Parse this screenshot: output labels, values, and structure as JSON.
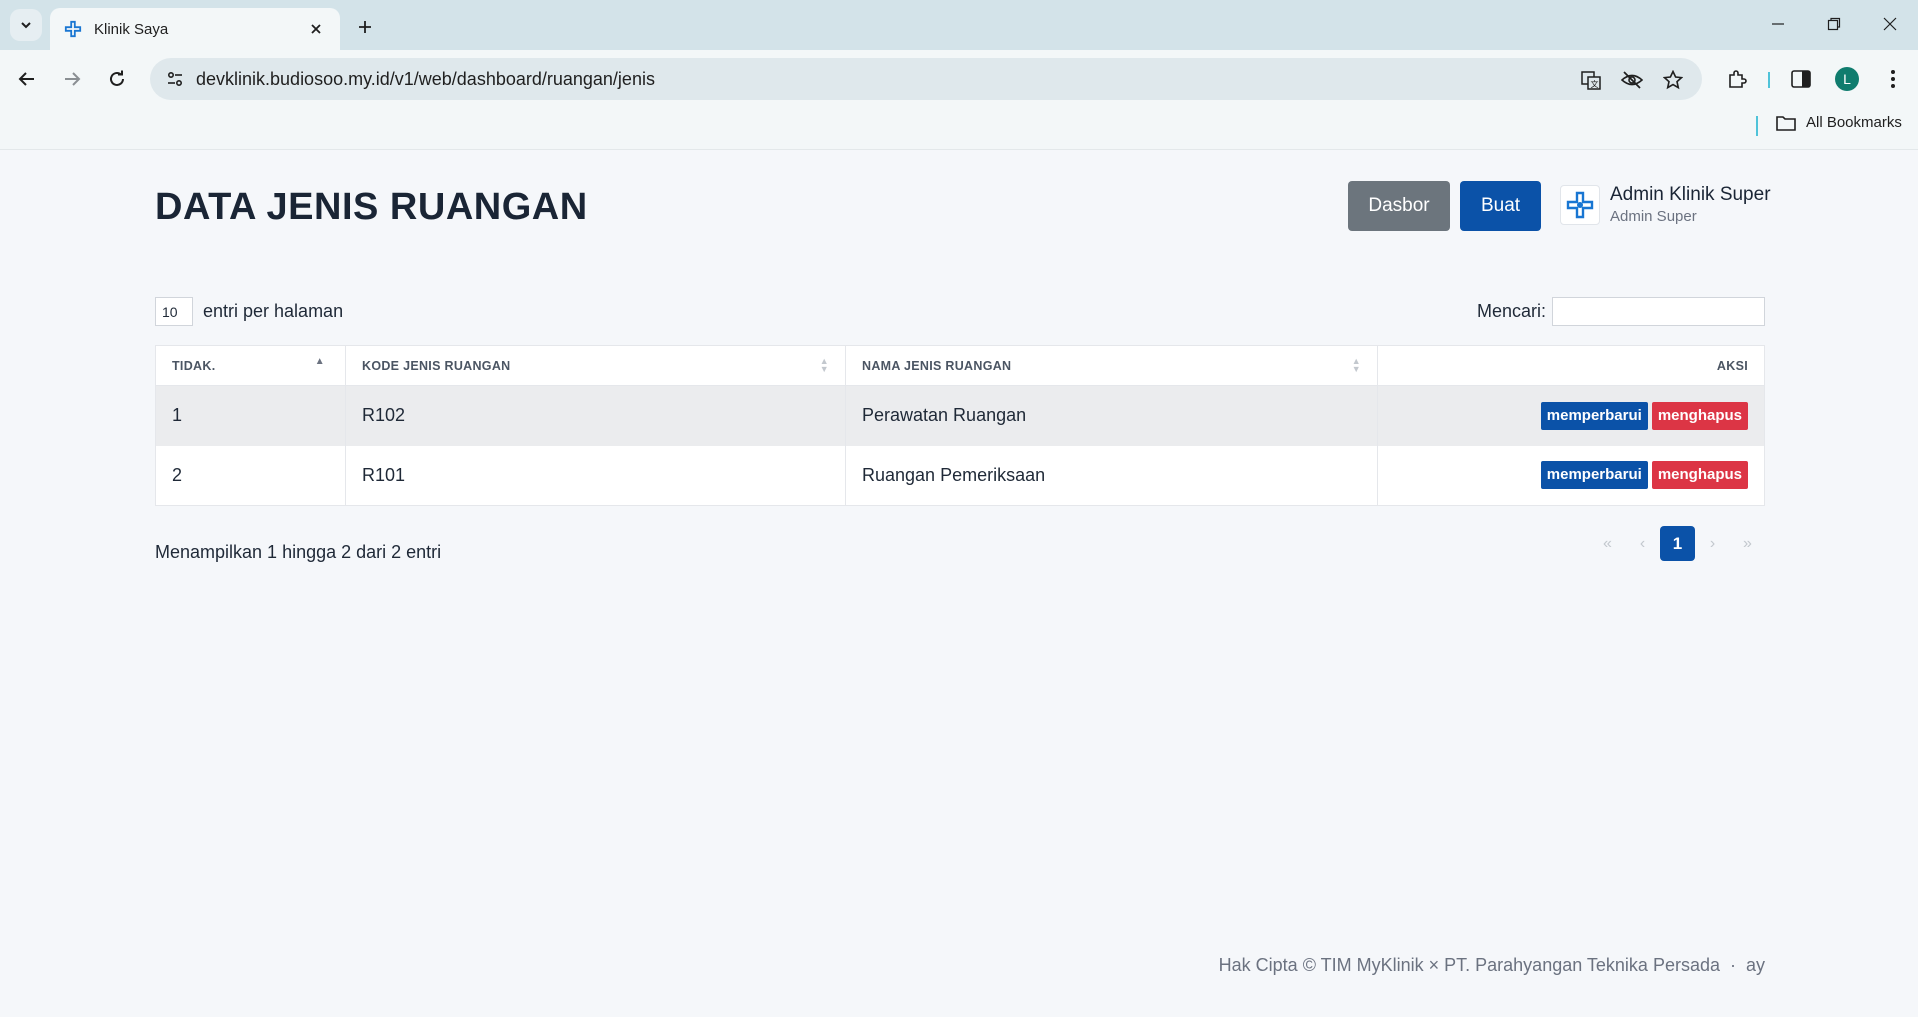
{
  "browser": {
    "tab_title": "Klinik Saya",
    "url": "devklinik.budiosoo.my.id/v1/web/dashboard/ruangan/jenis",
    "profile_initial": "L",
    "bookmarks_label": "All Bookmarks"
  },
  "header": {
    "title": "DATA JENIS RUANGAN",
    "dasbor_label": "Dasbor",
    "buat_label": "Buat",
    "user_name": "Admin Klinik Super",
    "user_role": "Admin Super"
  },
  "controls": {
    "entries_value": "10",
    "entries_label": "entri per halaman",
    "search_label": "Mencari:",
    "search_value": ""
  },
  "table": {
    "columns": [
      "TIDAK.",
      "KODE JENIS RUANGAN",
      "NAMA JENIS RUANGAN",
      "AKSI"
    ],
    "rows": [
      {
        "no": "1",
        "kode": "R102",
        "nama": "Perawatan Ruangan"
      },
      {
        "no": "2",
        "kode": "R101",
        "nama": "Ruangan Pemeriksaan"
      }
    ],
    "edit_label": "memperbarui",
    "delete_label": "menghapus"
  },
  "pagination": {
    "info": "Menampilkan 1 hingga 2 dari 2 entri",
    "first": "«",
    "prev": "‹",
    "current": "1",
    "next": "›",
    "last": "»"
  },
  "footer": {
    "text": "Hak Cipta © TIM MyKlinik × PT. Parahyangan Teknika Persada  ·  ay"
  },
  "colors": {
    "primary": "#0b52a8",
    "secondary": "#6c757d",
    "danger": "#dc3545"
  }
}
